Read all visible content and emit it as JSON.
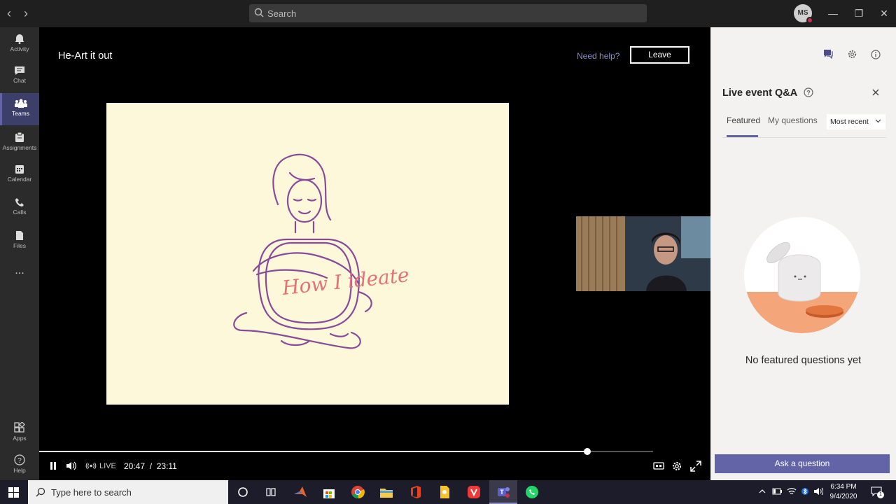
{
  "titlebar": {
    "search_placeholder": "Search",
    "avatar_initials": "MS"
  },
  "rail": {
    "items": [
      {
        "label": "Activity",
        "icon": "bell-icon"
      },
      {
        "label": "Chat",
        "icon": "chat-icon"
      },
      {
        "label": "Teams",
        "icon": "teams-icon",
        "active": true
      },
      {
        "label": "Assignments",
        "icon": "assignments-icon"
      },
      {
        "label": "Calendar",
        "icon": "calendar-icon"
      },
      {
        "label": "Calls",
        "icon": "phone-icon"
      },
      {
        "label": "Files",
        "icon": "file-icon"
      }
    ],
    "more": "...",
    "bottom": [
      {
        "label": "Apps",
        "icon": "apps-icon"
      },
      {
        "label": "Help",
        "icon": "help-icon"
      }
    ]
  },
  "stage": {
    "event_title": "He-Art it out",
    "need_help": "Need help?",
    "leave_label": "Leave",
    "slide_text": "How I ideate",
    "live_label": "LIVE",
    "time_current": "20:47",
    "time_sep": "/",
    "time_total": "23:11",
    "progress": 0.893
  },
  "panel": {
    "title": "Live event Q&A",
    "tab_featured": "Featured",
    "tab_my_questions": "My questions",
    "sort_selected": "Most recent",
    "empty_message": "No featured questions yet",
    "ask_button": "Ask a question"
  },
  "taskbar": {
    "search_placeholder": "Type here to search",
    "time": "6:34 PM",
    "date": "9/4/2020",
    "notification_count": "1"
  },
  "colors": {
    "accent": "#6264a7",
    "slide_bg": "#fdf8d9",
    "drawing": "#8a4a9a",
    "slide_text": "#e4707a",
    "jar_lid": "#f4a67a"
  }
}
